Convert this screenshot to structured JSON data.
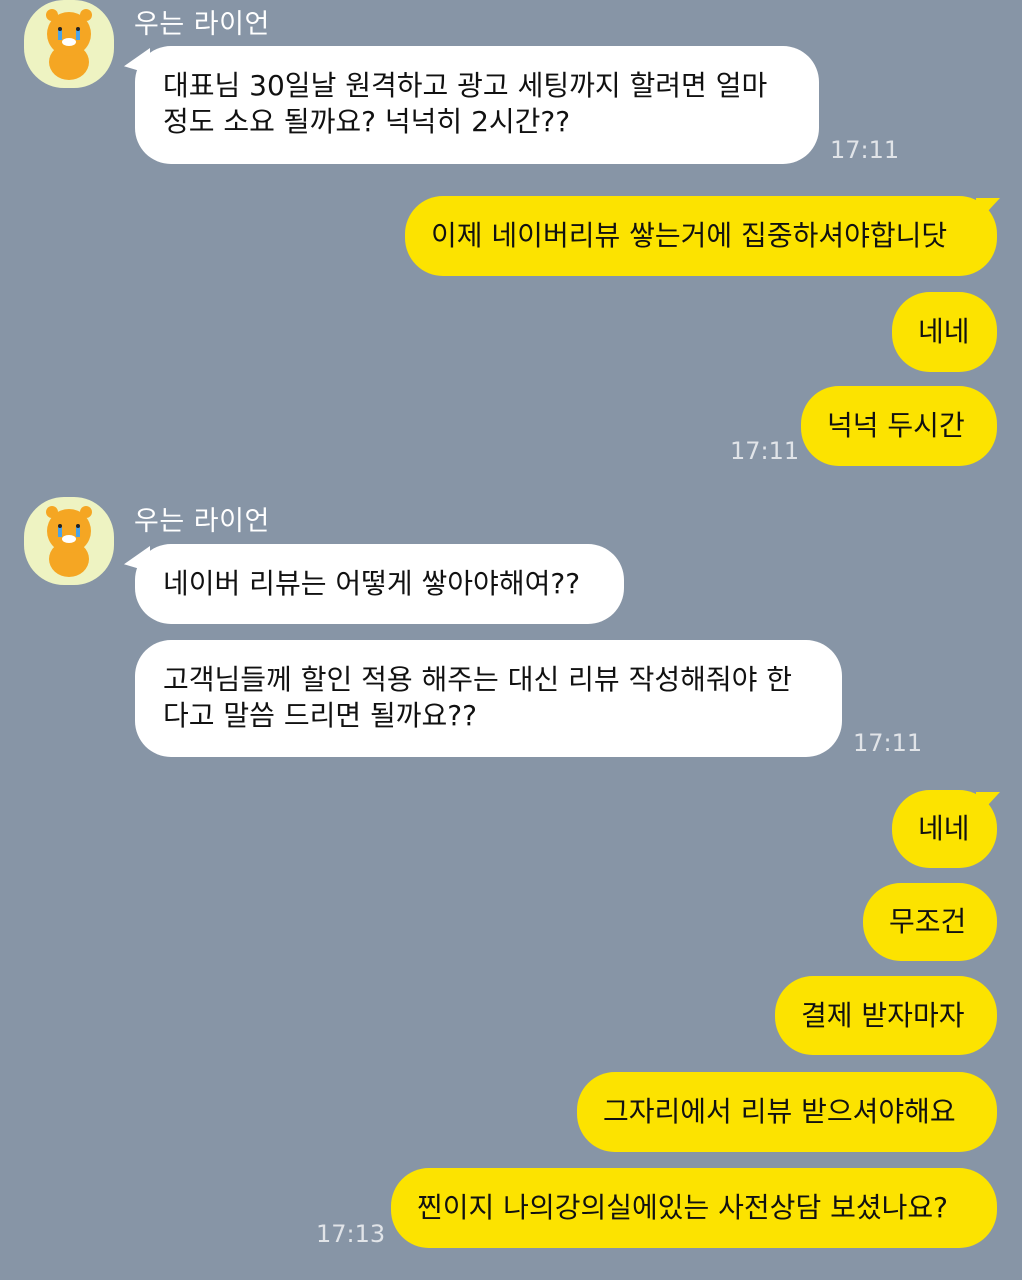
{
  "colors": {
    "background": "#8795a6",
    "incoming_bubble": "#ffffff",
    "outgoing_bubble": "#fce300",
    "avatar_bg": "#eef3c2",
    "lion": "#f5a623"
  },
  "messages": [
    {
      "sender": "우는 라이언",
      "avatar_icon": "crying-ryan-icon",
      "bubbles": [
        {
          "lines": [
            "대표님 30일날 원격하고 광고 세팅까지 할려면 얼마",
            "정도 소요 될까요?  넉넉히 2시간??"
          ],
          "time": "17:11"
        }
      ]
    },
    {
      "outgoing": true,
      "bubbles": [
        {
          "text": "이제 네이버리뷰 쌓는거에 집중하셔야합니닷"
        },
        {
          "text": "네네"
        },
        {
          "text": "넉넉 두시간",
          "time": "17:11"
        }
      ]
    },
    {
      "sender": "우는 라이언",
      "avatar_icon": "crying-ryan-icon",
      "bubbles": [
        {
          "lines": [
            "네이버 리뷰는 어떻게 쌓아야해여??"
          ]
        },
        {
          "lines": [
            "고객님들께 할인 적용 해주는 대신 리뷰 작성해줘야 한",
            "다고 말씀 드리면 될까요??"
          ],
          "time": "17:11"
        }
      ]
    },
    {
      "outgoing": true,
      "bubbles": [
        {
          "text": "네네"
        },
        {
          "text": "무조건"
        },
        {
          "text": "결제 받자마자"
        },
        {
          "text": "그자리에서 리뷰 받으셔야해요"
        },
        {
          "text": "찐이지 나의강의실에있는 사전상담 보셨나요?",
          "time": "17:13"
        }
      ]
    }
  ]
}
